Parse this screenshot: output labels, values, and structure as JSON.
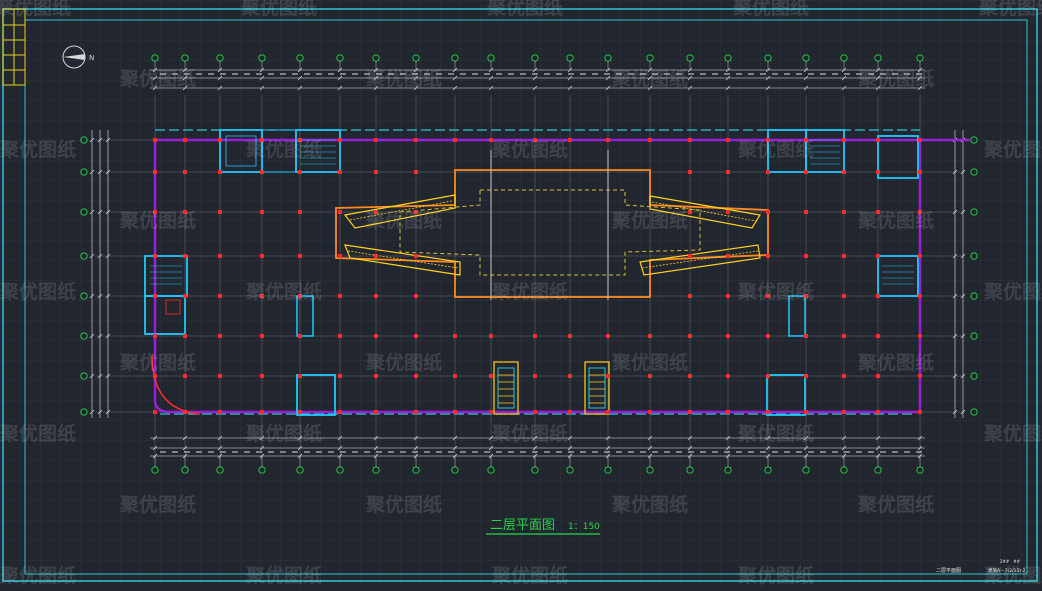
{
  "drawing": {
    "title": "二层平面图",
    "scale": "1：150",
    "watermark": "聚优图纸",
    "titleblock": {
      "sheet_name": "二层平面图",
      "sheet_no": "2##　##",
      "drawing_code": "建施A—7(2/15)-2"
    }
  },
  "colors": {
    "background": "#21262f",
    "grid": "#2c3340",
    "frame": "#2ec4d6",
    "wall": "#9b1fd6",
    "column": "#ff2a2a",
    "stair": "#1ec8ff",
    "atrium": "#ff8a1f",
    "escalator": "#ffd21e",
    "dimension": "#e8e8e8",
    "gridline": "#c8c8c8",
    "axis_bubble": "#27d64a",
    "title": "#27d64a"
  }
}
